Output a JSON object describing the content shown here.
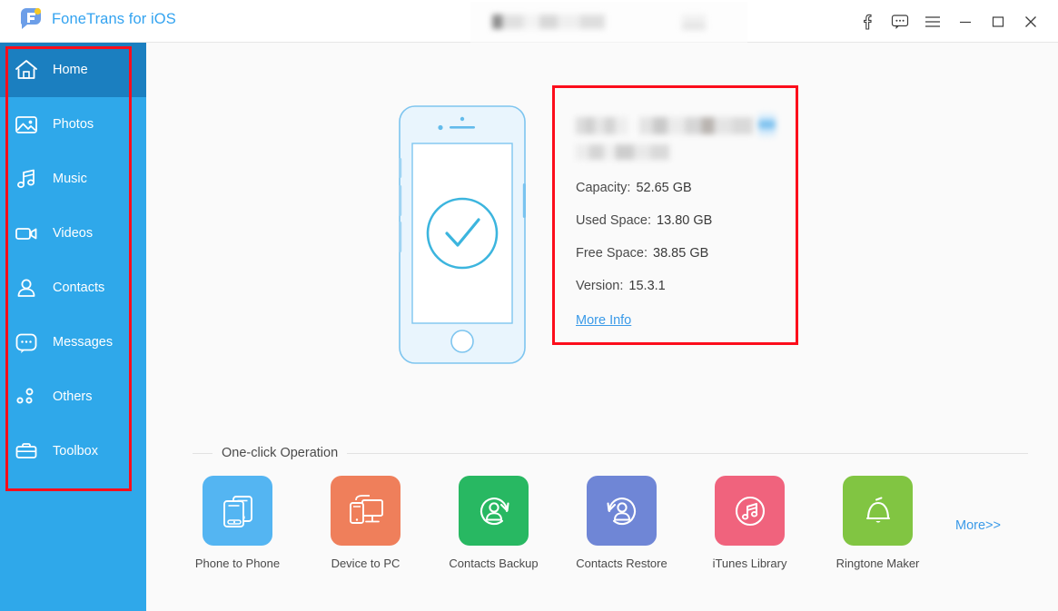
{
  "window": {
    "app_title": "FoneTrans for iOS",
    "brand_color": "#33a3f0",
    "accent_color": "#2fa8ea",
    "annotation_color": "#fc0d1b",
    "controls": [
      {
        "name": "facebook-icon",
        "label": "f"
      },
      {
        "name": "feedback-icon",
        "label": "Feedback"
      },
      {
        "name": "menu-icon",
        "label": "Menu"
      },
      {
        "name": "minimize-button",
        "label": "Minimize"
      },
      {
        "name": "maximize-button",
        "label": "Maximize"
      },
      {
        "name": "close-button",
        "label": "Close"
      }
    ]
  },
  "sidebar": {
    "items": [
      {
        "label": "Home",
        "icon": "home-icon",
        "active": true
      },
      {
        "label": "Photos",
        "icon": "photos-icon",
        "active": false
      },
      {
        "label": "Music",
        "icon": "music-icon",
        "active": false
      },
      {
        "label": "Videos",
        "icon": "videos-icon",
        "active": false
      },
      {
        "label": "Contacts",
        "icon": "contacts-icon",
        "active": false
      },
      {
        "label": "Messages",
        "icon": "messages-icon",
        "active": false
      },
      {
        "label": "Others",
        "icon": "others-icon",
        "active": false
      },
      {
        "label": "Toolbox",
        "icon": "toolbox-icon",
        "active": false
      }
    ]
  },
  "device": {
    "status_icon": "check-circle-icon",
    "name_redacted": true,
    "capacity_label": "Capacity:",
    "capacity_value": "52.65 GB",
    "used_label": "Used Space:",
    "used_value": "13.80 GB",
    "free_label": "Free Space:",
    "free_value": "38.85 GB",
    "version_label": "Version:",
    "version_value": "15.3.1",
    "more_info_label": "More Info"
  },
  "one_click": {
    "section_title": "One-click Operation",
    "more_label": "More>>",
    "tiles": [
      {
        "label": "Phone to Phone",
        "icon": "phone-to-phone-icon",
        "color": "#54b5f2"
      },
      {
        "label": "Device to PC",
        "icon": "device-to-pc-icon",
        "color": "#ef7f5b"
      },
      {
        "label": "Contacts Backup",
        "icon": "contacts-backup-icon",
        "color": "#28b862"
      },
      {
        "label": "Contacts Restore",
        "icon": "contacts-restore-icon",
        "color": "#6f86d6"
      },
      {
        "label": "iTunes Library",
        "icon": "itunes-library-icon",
        "color": "#f0637d"
      },
      {
        "label": "Ringtone Maker",
        "icon": "ringtone-maker-icon",
        "color": "#81c542"
      }
    ]
  }
}
